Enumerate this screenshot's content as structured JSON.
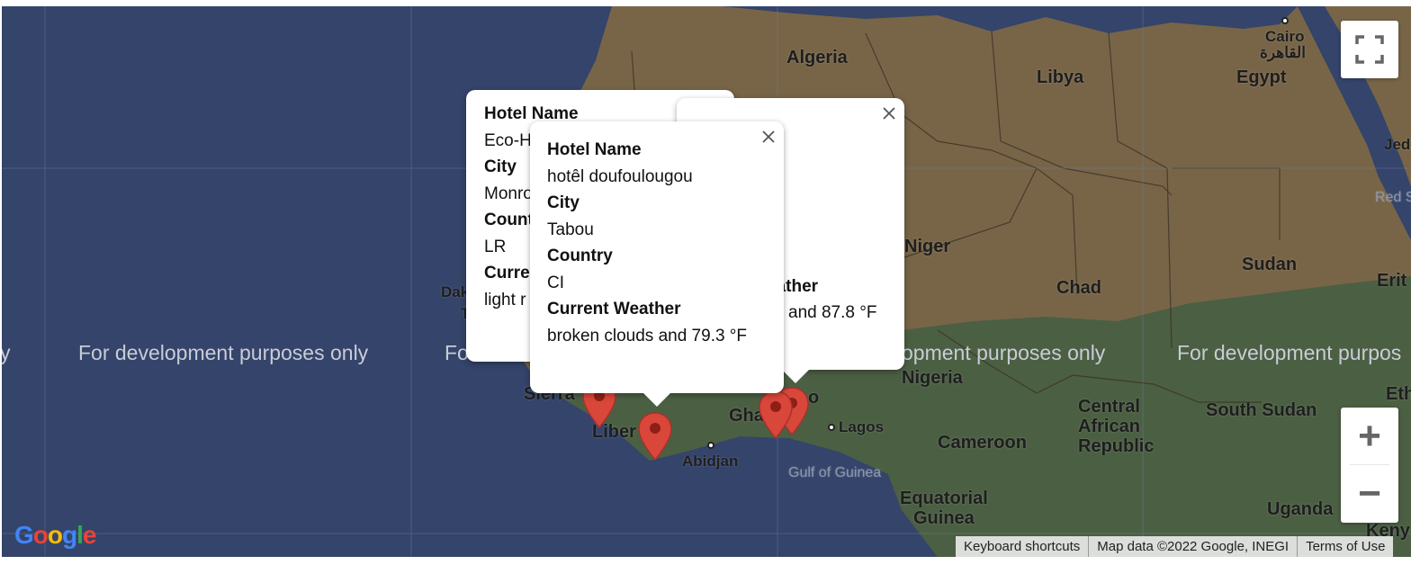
{
  "map": {
    "watermark": "For development purposes only",
    "watermark_left": "y",
    "watermark_right": "For development purpos",
    "watermark_mid_fragment": "Fo",
    "watermark_right_fragment": "opment purposes only"
  },
  "labels": {
    "algeria": "Algeria",
    "libya": "Libya",
    "egypt": "Egypt",
    "cairo": "Cairo",
    "cairo_ar": "القاهرة",
    "niger": "Niger",
    "chad": "Chad",
    "sudan": "Sudan",
    "eritrea": "Erit",
    "red_sea": "Red S",
    "jeddah": "Jed",
    "nigeria": "Nigeria",
    "central_african_republic": [
      "Central",
      "African",
      "Republic"
    ],
    "south_sudan": "South Sudan",
    "ethiopia": "Eth",
    "cameroon": "Cameroon",
    "lagos": "Lagos",
    "gulf_of_guinea": "Gulf of Guinea",
    "equatorial_guinea": [
      "Equatorial",
      "Guinea"
    ],
    "uganda": "Uganda",
    "kenya": "Keny",
    "abidjan": "Abidjan",
    "ghana": "Gha",
    "liberia": "Liber",
    "sierra_leone": "Sierra",
    "dakar": "Dak",
    "dakar2": "T",
    "togo": "o"
  },
  "infowindows": [
    {
      "id": "monrovia",
      "fields": [
        {
          "key": "Hotel Name",
          "value": "Eco-H"
        },
        {
          "key": "City",
          "value": "Monro"
        },
        {
          "key": "Count",
          "value": "LR"
        },
        {
          "key": "Curre",
          "value": "light r"
        }
      ]
    },
    {
      "id": "ghana",
      "fields": [
        {
          "key": "Hotel Name",
          "value": ""
        },
        {
          "key": "eather",
          "value": "and 87.8 °F"
        }
      ],
      "partial_title": "e"
    },
    {
      "id": "tabou",
      "fields": [
        {
          "key": "Hotel Name",
          "value": "hotêl doufoulougou"
        },
        {
          "key": "City",
          "value": "Tabou"
        },
        {
          "key": "Country",
          "value": "CI"
        },
        {
          "key": "Current Weather",
          "value": "broken clouds and 79.3 °F"
        }
      ]
    }
  ],
  "controls": {
    "fullscreen": "fullscreen-icon",
    "zoom_in": "+",
    "zoom_out": "−"
  },
  "footer": {
    "shortcuts": "Keyboard shortcuts",
    "map_data": "Map data ©2022 Google, INEGI",
    "terms": "Terms of Use"
  },
  "logo": "Google",
  "colors": {
    "ocean": "#34446a",
    "desert": "#786548",
    "vegetation": "#4b5f43",
    "marker": "#d9463a"
  }
}
